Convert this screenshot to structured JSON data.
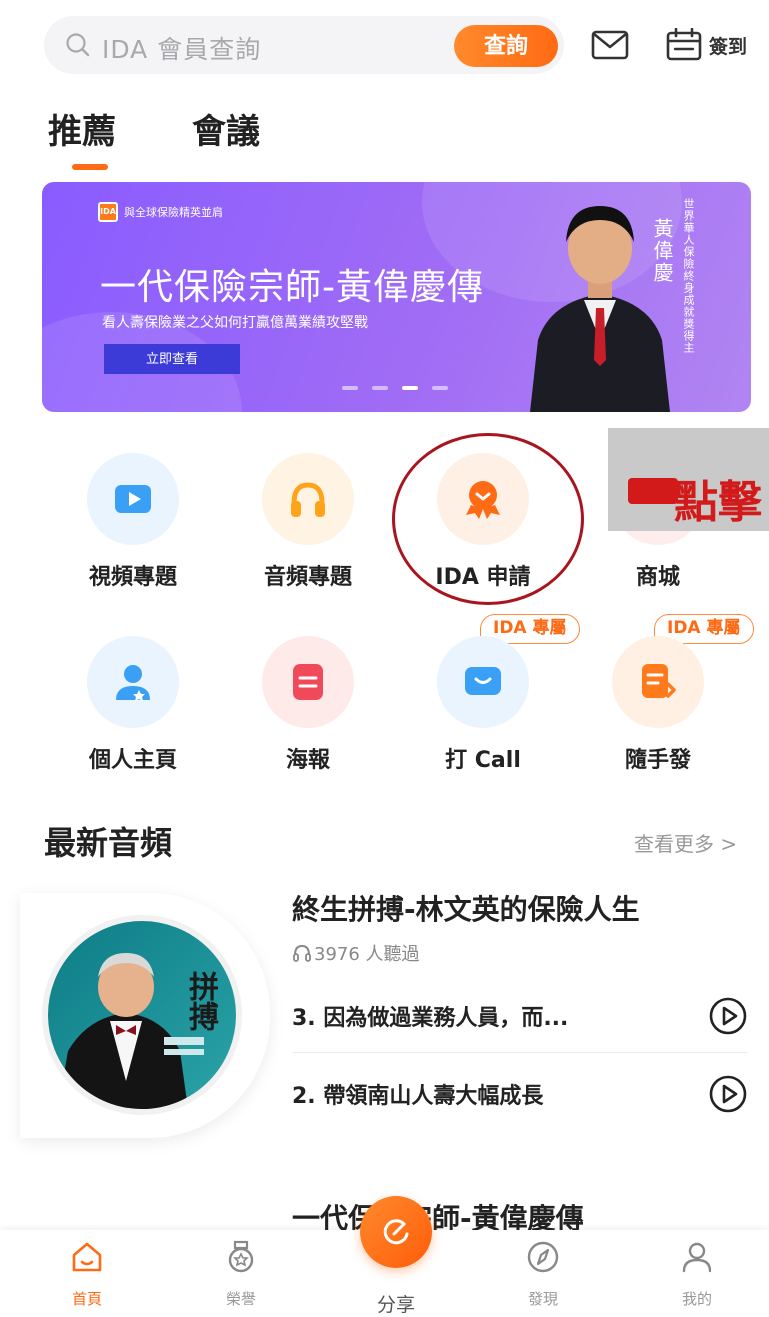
{
  "search": {
    "placeholder": "IDA 會員查詢",
    "button_label": "查詢"
  },
  "header": {
    "checkin_label": "簽到"
  },
  "tabs": [
    {
      "label": "推薦",
      "active": true
    },
    {
      "label": "會議",
      "active": false
    }
  ],
  "banner": {
    "badge_text": "IDA",
    "small_text": "與全球保險精英並肩",
    "title": "一代保險宗師-黃偉慶傳",
    "subtitle": "看人壽保險業之父如何打贏億萬業績攻堅戰",
    "button_label": "立即查看",
    "person_name": "黃偉慶",
    "person_caption": "世界華人保險終身成就獎得主"
  },
  "grid": [
    {
      "label": "視頻專題",
      "icon": "video-icon",
      "color": "#3aa0f5"
    },
    {
      "label": "音頻專題",
      "icon": "headphones-icon",
      "color": "#ffa31a"
    },
    {
      "label": "IDA 申請",
      "icon": "badge-ribbon-icon",
      "color": "#ff6a14"
    },
    {
      "label": "商城",
      "icon": "store-icon",
      "color": "#f04a4a"
    },
    {
      "label": "個人主頁",
      "icon": "user-profile-icon",
      "color": "#3aa0f5"
    },
    {
      "label": "海報",
      "icon": "poster-icon",
      "color": "#f04a5a"
    },
    {
      "label": "打 Call",
      "icon": "chat-call-icon",
      "color": "#3aa0f5"
    },
    {
      "label": "隨手發",
      "icon": "quick-post-icon",
      "color": "#ff7a1a"
    }
  ],
  "ida_tags": [
    "IDA 專屬",
    "IDA 專屬"
  ],
  "click_overlay_text": "點擊",
  "latest_audio": {
    "section_title": "最新音頻",
    "see_more": "查看更多 >",
    "album_text": "拼搏",
    "title": "終生拼搏-林文英的保險人生",
    "listens": "3976 人聽過",
    "episodes": [
      {
        "text": "3. 因為做過業務人員，而..."
      },
      {
        "text": "2. 帶領南山人壽大幅成長"
      }
    ],
    "next_title": "一代保險宗師-黃偉慶傳"
  },
  "bottom_nav": [
    {
      "label": "首頁",
      "icon": "home-icon",
      "active": true
    },
    {
      "label": "榮譽",
      "icon": "medal-icon",
      "active": false
    },
    {
      "label": "分享",
      "icon": "share-icon",
      "active": false
    },
    {
      "label": "發現",
      "icon": "compass-icon",
      "active": false
    },
    {
      "label": "我的",
      "icon": "user-icon",
      "active": false
    }
  ],
  "colors": {
    "accent": "#ff6a14",
    "banner": "#9a66f4",
    "annotation_red": "#a8151e"
  }
}
